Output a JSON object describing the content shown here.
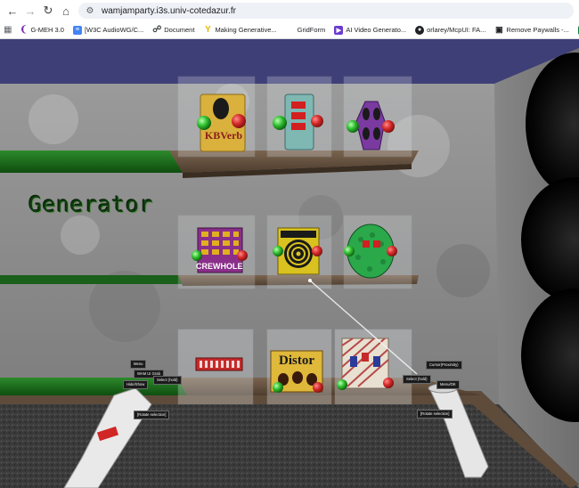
{
  "browser": {
    "url": "wamjamparty.i3s.univ-cotedazur.fr",
    "bookmarks": [
      {
        "label": "G-MEH 3.0",
        "icon": "gmeh-icon",
        "color": "#7b2fb5"
      },
      {
        "label": "[W3C AudioWG/C...",
        "icon": "document-icon",
        "color": "#4285f4"
      },
      {
        "label": "Document",
        "icon": "globe-icon",
        "color": "#5f6368"
      },
      {
        "label": "Making Generative...",
        "icon": "y-logo-icon",
        "color": "#e6b800"
      },
      {
        "label": "GridForm",
        "icon": "blank-icon",
        "color": "#ffffff"
      },
      {
        "label": "AI Video Generato...",
        "icon": "play-icon",
        "color": "#6a3bd1"
      },
      {
        "label": "orlarey/McpUI: FA...",
        "icon": "github-icon",
        "color": "#202124"
      },
      {
        "label": "Remove Paywalls -...",
        "icon": "lock-icon",
        "color": "#202124"
      }
    ]
  },
  "scene": {
    "section_label": "Generator",
    "pedals": {
      "kbverb": "KBVerb",
      "crewhole": "CREWHOLE",
      "distor": "Distor"
    },
    "left_controller": {
      "menu": "Menu",
      "wam_ui_grab": "WAM UI Grab",
      "select_hold": "Select (hold)",
      "hide_show": "Hide/Show",
      "rotate_selection": "[Rotate selection]"
    },
    "right_controller": {
      "cursor_proximity": "Cursor(Proximity)",
      "select_hold": "Select (hold)",
      "menu_ok": "Menu/OK",
      "rotate_selection": "[Rotate selection]"
    },
    "colors": {
      "wall": "#8f8f8f",
      "shelf_wood": "#5e4b3a",
      "green_board": "#1f6b1f",
      "ceiling": "#3f3f77",
      "knob_red": "#d62a2a",
      "knob_green": "#2fbf2f"
    }
  }
}
